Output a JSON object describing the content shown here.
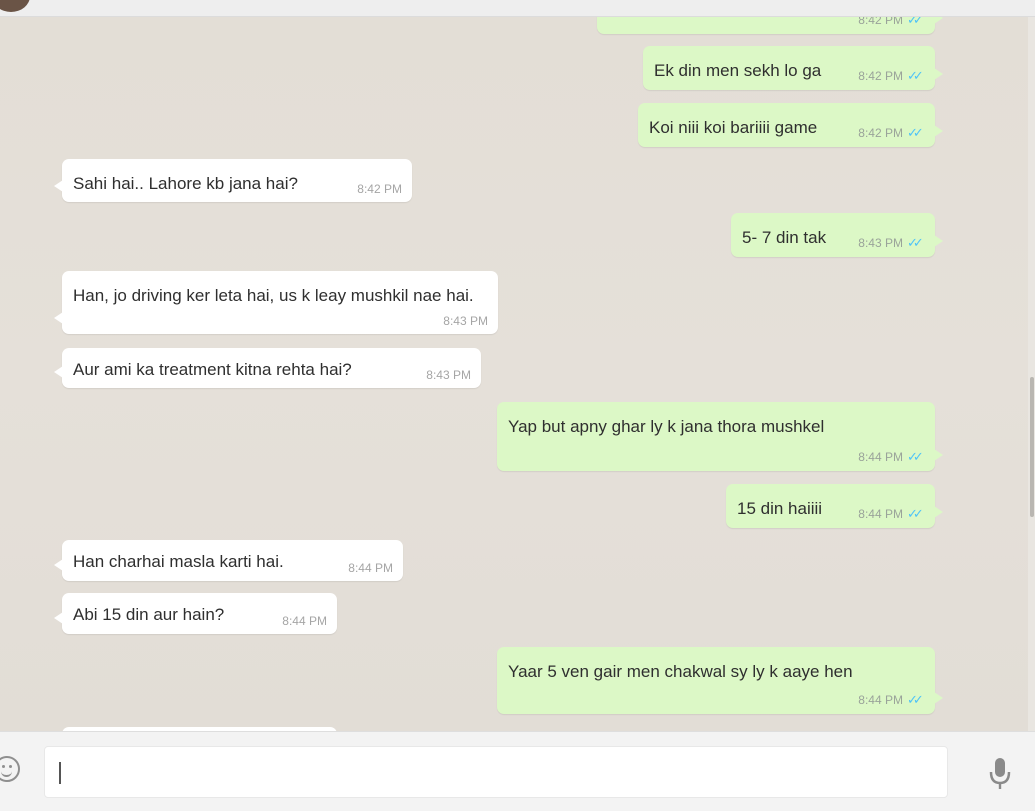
{
  "input": {
    "placeholder": ""
  },
  "messages": [
    {
      "dir": "out",
      "text": "",
      "time": "8:42 PM",
      "status": "read"
    },
    {
      "dir": "out",
      "text": "Ek din men sekh lo ga",
      "time": "8:42 PM",
      "status": "read"
    },
    {
      "dir": "out",
      "text": "Koi niii koi bariiii game",
      "time": "8:42 PM",
      "status": "read"
    },
    {
      "dir": "in",
      "text": "Sahi hai.. Lahore kb jana hai?",
      "time": "8:42 PM"
    },
    {
      "dir": "out",
      "text": "5- 7 din tak",
      "time": "8:43 PM",
      "status": "read"
    },
    {
      "dir": "in",
      "text": "Han, jo driving ker leta hai, us k leay mushkil nae hai.",
      "time": "8:43 PM"
    },
    {
      "dir": "in",
      "text": "Aur ami ka treatment kitna rehta hai?",
      "time": "8:43 PM"
    },
    {
      "dir": "out",
      "text": "Yap but apny ghar ly k jana thora mushkel",
      "time": "8:44 PM",
      "status": "read"
    },
    {
      "dir": "out",
      "text": "15 din haiiii",
      "time": "8:44 PM",
      "status": "read"
    },
    {
      "dir": "in",
      "text": "Han charhai masla karti hai.",
      "time": "8:44 PM"
    },
    {
      "dir": "in",
      "text": "Abi 15 din aur hain?",
      "time": "8:44 PM"
    },
    {
      "dir": "out",
      "text": "Yaar 5 ven gair men chakwal sy ly k aaye hen",
      "time": "8:44 PM",
      "status": "read"
    },
    {
      "dir": "in",
      "text": "",
      "time": ""
    }
  ],
  "icons": {
    "emoji": "emoji-icon",
    "mic": "mic-icon",
    "read_receipt": "double-check-icon"
  },
  "colors": {
    "outgoing_bubble": "#dcf8c6",
    "incoming_bubble": "#ffffff",
    "read_check": "#4fc3f7",
    "chat_background": "#e5e0d9"
  }
}
